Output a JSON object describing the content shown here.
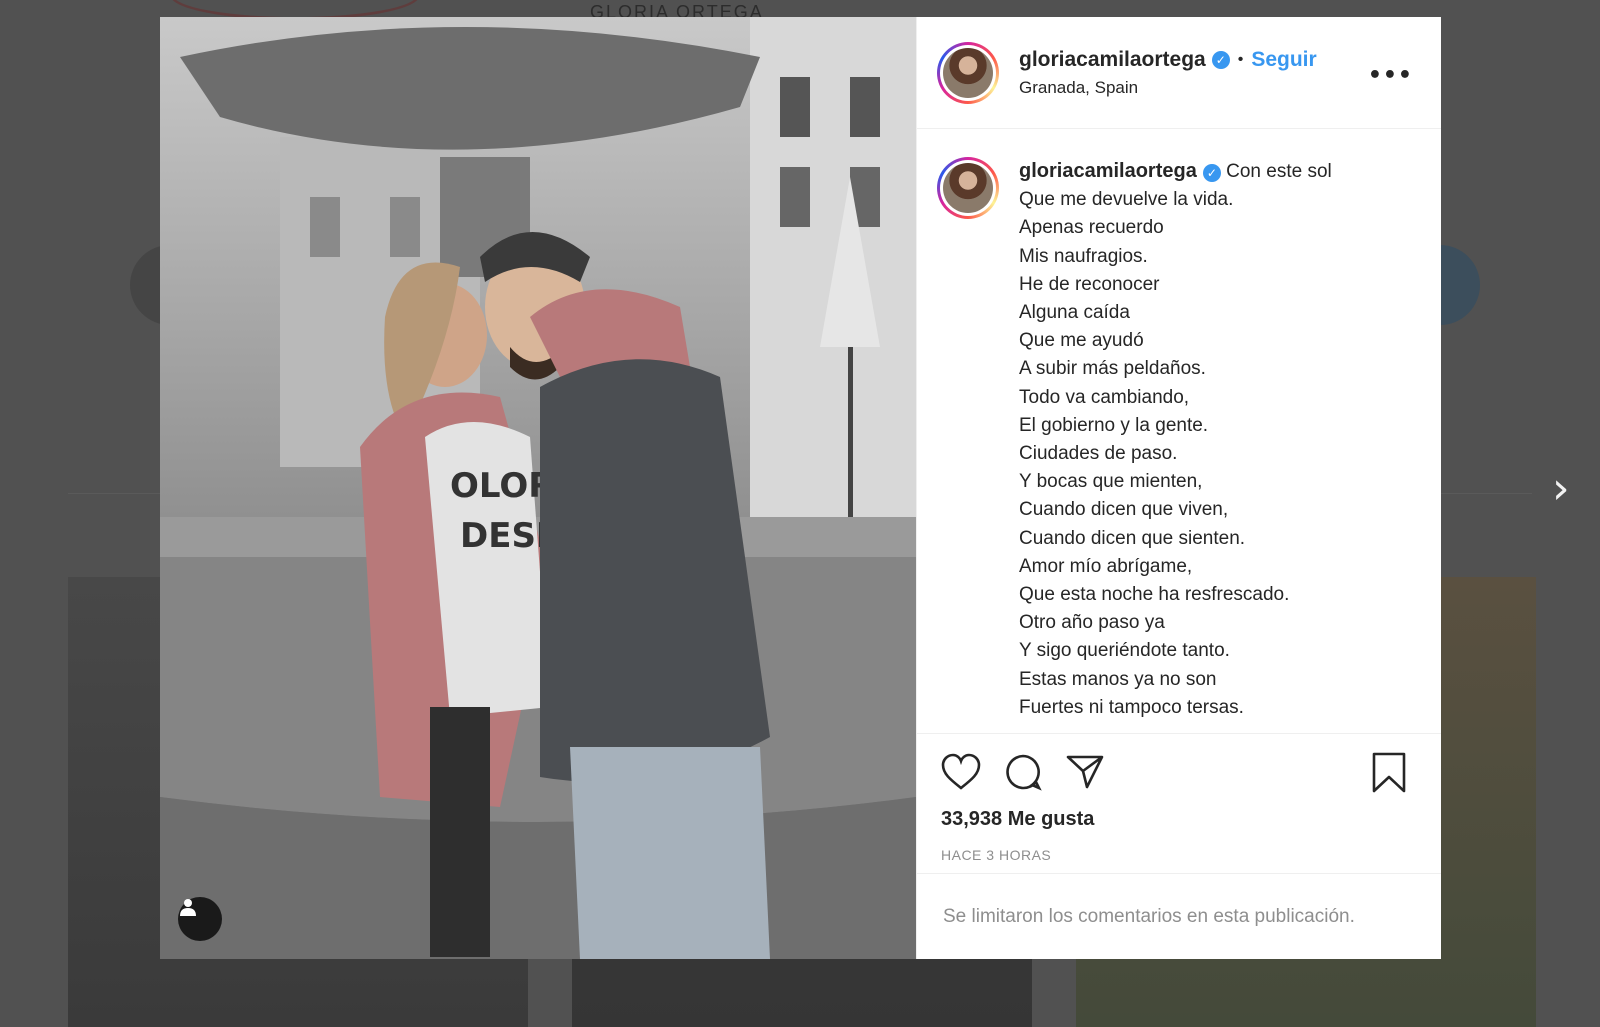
{
  "background": {
    "header_name": "GLORIA ORTEGA"
  },
  "post": {
    "username": "gloriacamilaortega",
    "verified": true,
    "follow_label": "Seguir",
    "location": "Granada, Spain",
    "more_label": "•••",
    "caption_lines": [
      "Con este sol",
      "Que me devuelve la vida.",
      "Apenas recuerdo",
      "Mis naufragios.",
      "He de reconocer",
      "Alguna caída",
      "Que me ayudó",
      "A subir más peldaños.",
      "Todo va cambiando,",
      "El gobierno y la gente.",
      "Ciudades de paso.",
      "Y bocas que mienten,",
      "Cuando dicen que viven,",
      "Cuando dicen que sienten.",
      "Amor mío abrígame,",
      "Que esta noche ha resfrescado.",
      "Otro año paso ya",
      "Y sigo queriéndote tanto.",
      "Estas manos ya no son",
      "Fuertes ni tampoco tersas."
    ],
    "likes_text": "33,938 Me gusta",
    "time_text": "HACE 3 HORAS",
    "comments_disabled_text": "Se limitaron los comentarios en esta publicación."
  },
  "colors": {
    "accent": "#3897f0",
    "text": "#262626",
    "muted": "#8e8e8e"
  },
  "icons": [
    "heart-icon",
    "comment-icon",
    "share-icon",
    "bookmark-icon",
    "user-tag-icon",
    "verified-badge-icon",
    "more-options-icon",
    "chevron-right-icon"
  ]
}
